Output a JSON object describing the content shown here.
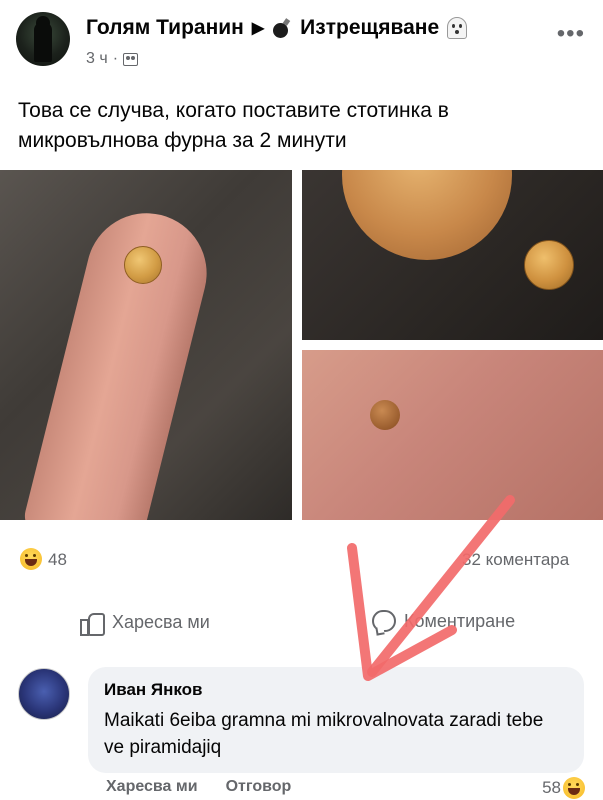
{
  "post": {
    "group_name": "Голям Тиранин",
    "separator_icon": "play-triangle-icon",
    "page_name": "Изтрещяване",
    "time": "3 ч",
    "text": "Това се случва, когато поставите стотинка в микровълнова фурна за 2 минути",
    "photo_labels": []
  },
  "stats": {
    "reaction_icon": "laughing-emoji-icon",
    "reactions_count": "48",
    "comments_count": "32 коментара"
  },
  "actions": {
    "like_label": "Харесва ми",
    "comment_label": "Коментиране"
  },
  "comment": {
    "author": "Иван Янков",
    "text": "Maikati 6eiba gramna mi mikrovalnovata zaradi tebe ve piramidajiq",
    "like_label": "Харесва ми",
    "reply_label": "Отговор",
    "reactions_count": "58"
  },
  "colors": {
    "secondary_text": "#65676b",
    "comment_bubble": "#f0f2f5",
    "annotation_arrow": "#f26a6a"
  }
}
